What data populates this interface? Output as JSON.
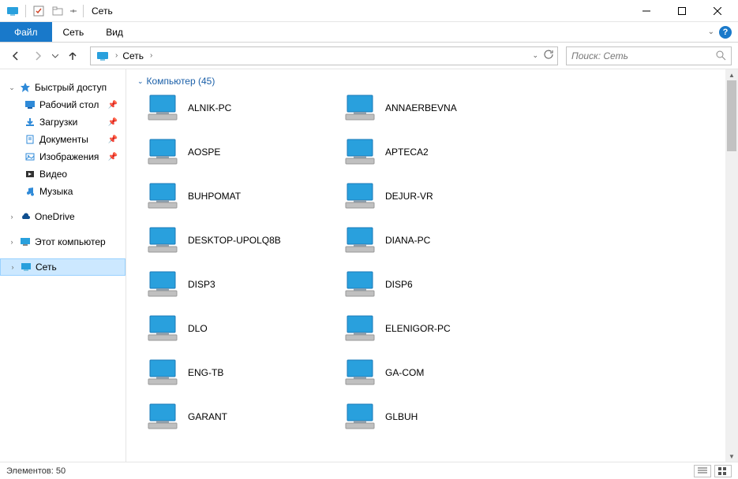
{
  "window": {
    "title": "Сеть"
  },
  "ribbon": {
    "file": "Файл",
    "tabs": [
      "Сеть",
      "Вид"
    ]
  },
  "address": {
    "root": "Сеть"
  },
  "search": {
    "placeholder": "Поиск: Сеть"
  },
  "sidebar": {
    "quick": "Быстрый доступ",
    "quick_items": [
      {
        "label": "Рабочий стол",
        "pin": true,
        "icon": "desktop"
      },
      {
        "label": "Загрузки",
        "pin": true,
        "icon": "downloads"
      },
      {
        "label": "Документы",
        "pin": true,
        "icon": "documents"
      },
      {
        "label": "Изображения",
        "pin": true,
        "icon": "pictures"
      },
      {
        "label": "Видео",
        "pin": false,
        "icon": "videos"
      },
      {
        "label": "Музыка",
        "pin": false,
        "icon": "music"
      }
    ],
    "onedrive": "OneDrive",
    "thispc": "Этот компьютер",
    "network": "Сеть"
  },
  "group": {
    "name": "Компьютер",
    "count": "45"
  },
  "computers": [
    [
      "ALNIK-PC",
      "ANNAERBEVNA"
    ],
    [
      "AOSPE",
      "APTECA2"
    ],
    [
      "BUHPOMAT",
      "DEJUR-VR"
    ],
    [
      "DESKTOP-UPOLQ8B",
      "DIANA-PC"
    ],
    [
      "DISP3",
      "DISP6"
    ],
    [
      "DLO",
      "ELENIGOR-PC"
    ],
    [
      "ENG-TB",
      "GA-COM"
    ],
    [
      "GARANT",
      "GLBUH"
    ]
  ],
  "status": {
    "label": "Элементов:",
    "count": "50"
  }
}
